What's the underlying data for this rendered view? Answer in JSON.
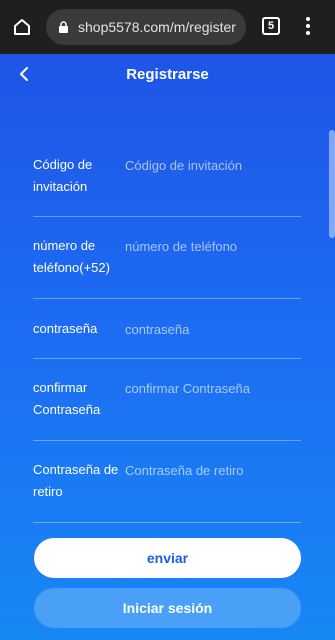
{
  "browser": {
    "url": "shop5578.com/m/register",
    "tab_count": "5"
  },
  "header": {
    "title": "Registrarse"
  },
  "form": {
    "fields": [
      {
        "label": "Código de invitación",
        "placeholder": "Código de invitación",
        "value": ""
      },
      {
        "label": "número de teléfono(+52)",
        "placeholder": "número de teléfono",
        "value": ""
      },
      {
        "label": "contraseña",
        "placeholder": "contraseña",
        "value": ""
      },
      {
        "label": "confirmar Contraseña",
        "placeholder": "confirmar Contraseña",
        "value": ""
      },
      {
        "label": "Contraseña de retiro",
        "placeholder": "Contraseña de retiro",
        "value": ""
      }
    ]
  },
  "actions": {
    "submit_label": "enviar",
    "login_label": "Iniciar sesión"
  },
  "colors": {
    "chrome_bg": "#1f1f1f",
    "gradient_top": "#1e55e6",
    "gradient_bottom": "#1788f4",
    "primary_text": "#1d5fe0"
  }
}
